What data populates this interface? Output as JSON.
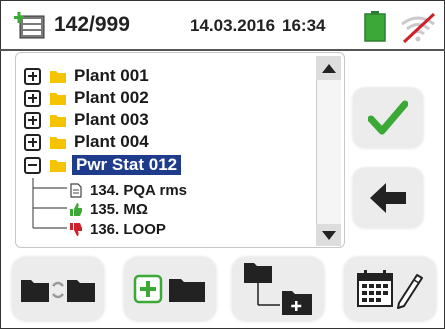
{
  "header": {
    "counter": "142/999",
    "date": "14.03.2016",
    "time": "16:34",
    "icons": [
      "memory-add-icon",
      "battery-icon",
      "wifi-off-icon"
    ]
  },
  "tree": {
    "folders": [
      {
        "label": "Plant 001",
        "expanded": false,
        "selected": false
      },
      {
        "label": "Plant 002",
        "expanded": false,
        "selected": false
      },
      {
        "label": "Plant 003",
        "expanded": false,
        "selected": false
      },
      {
        "label": "Plant 004",
        "expanded": false,
        "selected": false
      },
      {
        "label": "Pwr Stat 012",
        "expanded": true,
        "selected": true
      }
    ],
    "children": [
      {
        "label": "134. PQA rms",
        "icon": "document-icon"
      },
      {
        "label": "135. MΩ",
        "icon": "thumbs-up-icon"
      },
      {
        "label": "136. LOOP",
        "icon": "thumbs-down-icon"
      }
    ]
  },
  "side_buttons": {
    "confirm": "check-icon",
    "back": "arrow-left-icon"
  },
  "bottom_buttons": [
    "rename-folder-icon",
    "new-folder-icon",
    "new-subfolder-icon",
    "calendar-edit-icon"
  ],
  "colors": {
    "accent_green": "#3aa935",
    "selection_blue": "#1e3b8c",
    "folder_yellow": "#f4c400",
    "alert_red": "#d0202a"
  }
}
